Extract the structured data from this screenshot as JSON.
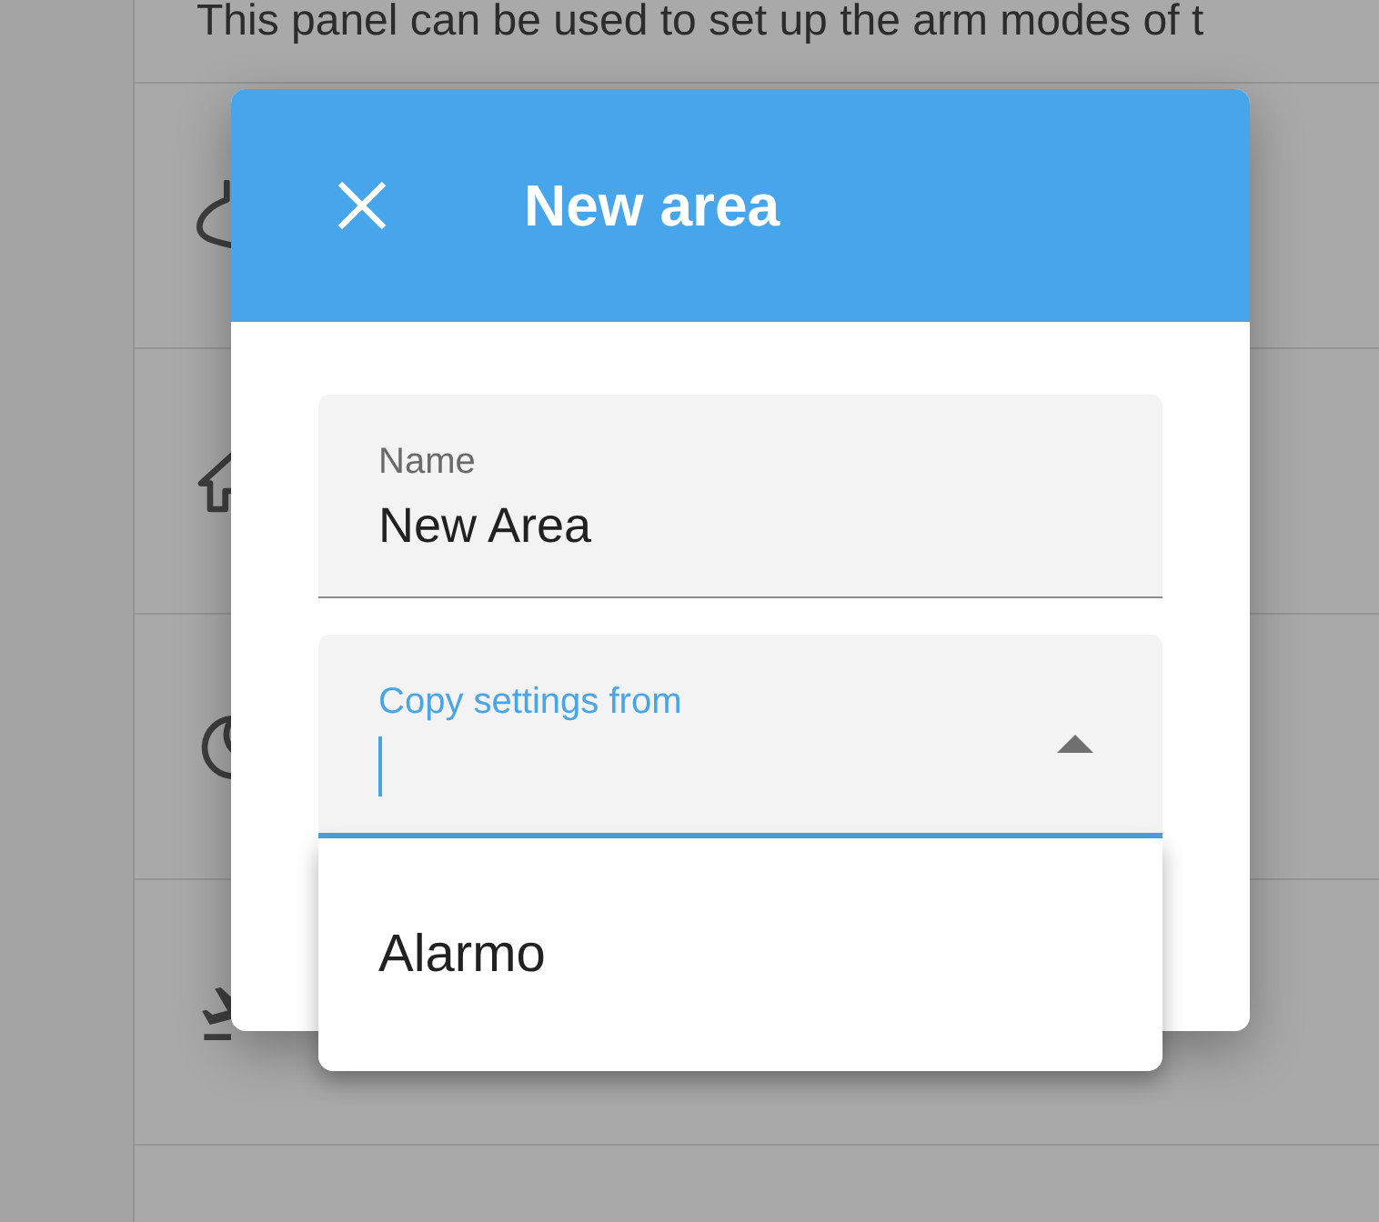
{
  "background_page": {
    "description": "This panel can be used to set up the arm modes of t"
  },
  "dialog": {
    "title": "New area",
    "fields": [
      {
        "kind": "text",
        "label": "Name",
        "value": "New Area",
        "focused": false
      },
      {
        "kind": "select",
        "label": "Copy settings from",
        "focused": true,
        "expanded": true,
        "options": [
          {
            "label": "Alarmo",
            "selected": false
          }
        ]
      }
    ]
  }
}
